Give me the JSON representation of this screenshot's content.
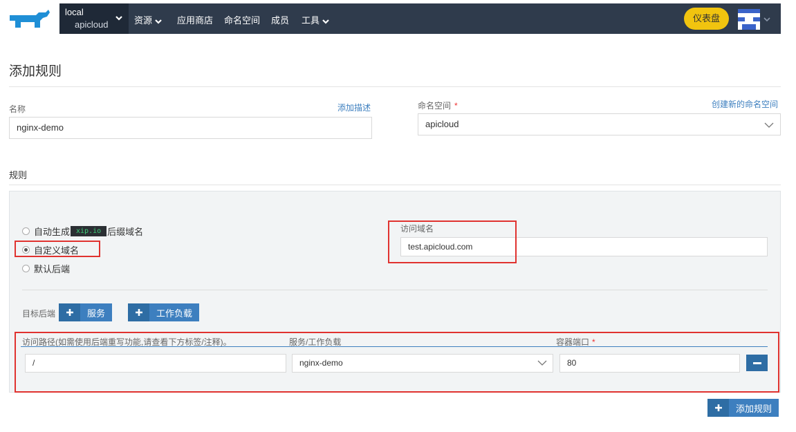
{
  "nav": {
    "cluster_label": "local",
    "project_label": "apicloud",
    "items": [
      {
        "label": "资源",
        "has_menu": true
      },
      {
        "label": "应用商店",
        "has_menu": false
      },
      {
        "label": "命名空间",
        "has_menu": false
      },
      {
        "label": "成员",
        "has_menu": false
      },
      {
        "label": "工具",
        "has_menu": true
      }
    ],
    "dashboard_label": "仪表盘"
  },
  "page": {
    "title": "添加规则"
  },
  "form": {
    "name_label": "名称",
    "add_desc_link": "添加描述",
    "name_value": "nginx-demo",
    "namespace_label": "命名空间",
    "required_mark": "*",
    "create_ns_link": "创建新的命名空间",
    "namespace_value": "apicloud"
  },
  "rules": {
    "section_title": "规则",
    "options": {
      "auto_prefix": "自动生成",
      "auto_badge": "xip.io",
      "auto_suffix": "后缀域名",
      "custom": "自定义域名",
      "default_backend": "默认后端"
    },
    "selected_option": "custom",
    "host_label": "访问域名",
    "host_value": "test.apicloud.com",
    "target_backend_label": "目标后端",
    "add_service_label": "服务",
    "add_workload_label": "工作负载",
    "columns": {
      "path": "访问路径(如需使用后端重写功能,请查看下方标签/注释)。",
      "target": "服务/工作负载",
      "port": "容器端口"
    },
    "row": {
      "path": "/",
      "target": "nginx-demo",
      "port": "80"
    }
  },
  "footer": {
    "add_rule_label": "添加规则"
  },
  "colors": {
    "accent": "#3d7fbf",
    "navbar": "#2f3b4c",
    "highlight": "#e0322f",
    "dashboard": "#f1c40f"
  }
}
